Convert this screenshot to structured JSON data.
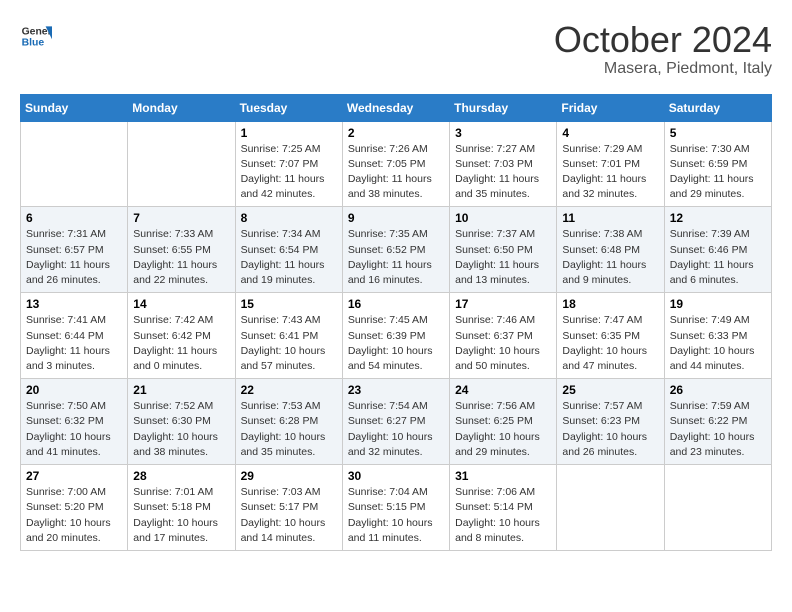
{
  "logo": {
    "line1": "General",
    "line2": "Blue"
  },
  "title": "October 2024",
  "subtitle": "Masera, Piedmont, Italy",
  "header_days": [
    "Sunday",
    "Monday",
    "Tuesday",
    "Wednesday",
    "Thursday",
    "Friday",
    "Saturday"
  ],
  "weeks": [
    [
      {
        "day": "",
        "sunrise": "",
        "sunset": "",
        "daylight": ""
      },
      {
        "day": "",
        "sunrise": "",
        "sunset": "",
        "daylight": ""
      },
      {
        "day": "1",
        "sunrise": "Sunrise: 7:25 AM",
        "sunset": "Sunset: 7:07 PM",
        "daylight": "Daylight: 11 hours and 42 minutes."
      },
      {
        "day": "2",
        "sunrise": "Sunrise: 7:26 AM",
        "sunset": "Sunset: 7:05 PM",
        "daylight": "Daylight: 11 hours and 38 minutes."
      },
      {
        "day": "3",
        "sunrise": "Sunrise: 7:27 AM",
        "sunset": "Sunset: 7:03 PM",
        "daylight": "Daylight: 11 hours and 35 minutes."
      },
      {
        "day": "4",
        "sunrise": "Sunrise: 7:29 AM",
        "sunset": "Sunset: 7:01 PM",
        "daylight": "Daylight: 11 hours and 32 minutes."
      },
      {
        "day": "5",
        "sunrise": "Sunrise: 7:30 AM",
        "sunset": "Sunset: 6:59 PM",
        "daylight": "Daylight: 11 hours and 29 minutes."
      }
    ],
    [
      {
        "day": "6",
        "sunrise": "Sunrise: 7:31 AM",
        "sunset": "Sunset: 6:57 PM",
        "daylight": "Daylight: 11 hours and 26 minutes."
      },
      {
        "day": "7",
        "sunrise": "Sunrise: 7:33 AM",
        "sunset": "Sunset: 6:55 PM",
        "daylight": "Daylight: 11 hours and 22 minutes."
      },
      {
        "day": "8",
        "sunrise": "Sunrise: 7:34 AM",
        "sunset": "Sunset: 6:54 PM",
        "daylight": "Daylight: 11 hours and 19 minutes."
      },
      {
        "day": "9",
        "sunrise": "Sunrise: 7:35 AM",
        "sunset": "Sunset: 6:52 PM",
        "daylight": "Daylight: 11 hours and 16 minutes."
      },
      {
        "day": "10",
        "sunrise": "Sunrise: 7:37 AM",
        "sunset": "Sunset: 6:50 PM",
        "daylight": "Daylight: 11 hours and 13 minutes."
      },
      {
        "day": "11",
        "sunrise": "Sunrise: 7:38 AM",
        "sunset": "Sunset: 6:48 PM",
        "daylight": "Daylight: 11 hours and 9 minutes."
      },
      {
        "day": "12",
        "sunrise": "Sunrise: 7:39 AM",
        "sunset": "Sunset: 6:46 PM",
        "daylight": "Daylight: 11 hours and 6 minutes."
      }
    ],
    [
      {
        "day": "13",
        "sunrise": "Sunrise: 7:41 AM",
        "sunset": "Sunset: 6:44 PM",
        "daylight": "Daylight: 11 hours and 3 minutes."
      },
      {
        "day": "14",
        "sunrise": "Sunrise: 7:42 AM",
        "sunset": "Sunset: 6:42 PM",
        "daylight": "Daylight: 11 hours and 0 minutes."
      },
      {
        "day": "15",
        "sunrise": "Sunrise: 7:43 AM",
        "sunset": "Sunset: 6:41 PM",
        "daylight": "Daylight: 10 hours and 57 minutes."
      },
      {
        "day": "16",
        "sunrise": "Sunrise: 7:45 AM",
        "sunset": "Sunset: 6:39 PM",
        "daylight": "Daylight: 10 hours and 54 minutes."
      },
      {
        "day": "17",
        "sunrise": "Sunrise: 7:46 AM",
        "sunset": "Sunset: 6:37 PM",
        "daylight": "Daylight: 10 hours and 50 minutes."
      },
      {
        "day": "18",
        "sunrise": "Sunrise: 7:47 AM",
        "sunset": "Sunset: 6:35 PM",
        "daylight": "Daylight: 10 hours and 47 minutes."
      },
      {
        "day": "19",
        "sunrise": "Sunrise: 7:49 AM",
        "sunset": "Sunset: 6:33 PM",
        "daylight": "Daylight: 10 hours and 44 minutes."
      }
    ],
    [
      {
        "day": "20",
        "sunrise": "Sunrise: 7:50 AM",
        "sunset": "Sunset: 6:32 PM",
        "daylight": "Daylight: 10 hours and 41 minutes."
      },
      {
        "day": "21",
        "sunrise": "Sunrise: 7:52 AM",
        "sunset": "Sunset: 6:30 PM",
        "daylight": "Daylight: 10 hours and 38 minutes."
      },
      {
        "day": "22",
        "sunrise": "Sunrise: 7:53 AM",
        "sunset": "Sunset: 6:28 PM",
        "daylight": "Daylight: 10 hours and 35 minutes."
      },
      {
        "day": "23",
        "sunrise": "Sunrise: 7:54 AM",
        "sunset": "Sunset: 6:27 PM",
        "daylight": "Daylight: 10 hours and 32 minutes."
      },
      {
        "day": "24",
        "sunrise": "Sunrise: 7:56 AM",
        "sunset": "Sunset: 6:25 PM",
        "daylight": "Daylight: 10 hours and 29 minutes."
      },
      {
        "day": "25",
        "sunrise": "Sunrise: 7:57 AM",
        "sunset": "Sunset: 6:23 PM",
        "daylight": "Daylight: 10 hours and 26 minutes."
      },
      {
        "day": "26",
        "sunrise": "Sunrise: 7:59 AM",
        "sunset": "Sunset: 6:22 PM",
        "daylight": "Daylight: 10 hours and 23 minutes."
      }
    ],
    [
      {
        "day": "27",
        "sunrise": "Sunrise: 7:00 AM",
        "sunset": "Sunset: 5:20 PM",
        "daylight": "Daylight: 10 hours and 20 minutes."
      },
      {
        "day": "28",
        "sunrise": "Sunrise: 7:01 AM",
        "sunset": "Sunset: 5:18 PM",
        "daylight": "Daylight: 10 hours and 17 minutes."
      },
      {
        "day": "29",
        "sunrise": "Sunrise: 7:03 AM",
        "sunset": "Sunset: 5:17 PM",
        "daylight": "Daylight: 10 hours and 14 minutes."
      },
      {
        "day": "30",
        "sunrise": "Sunrise: 7:04 AM",
        "sunset": "Sunset: 5:15 PM",
        "daylight": "Daylight: 10 hours and 11 minutes."
      },
      {
        "day": "31",
        "sunrise": "Sunrise: 7:06 AM",
        "sunset": "Sunset: 5:14 PM",
        "daylight": "Daylight: 10 hours and 8 minutes."
      },
      {
        "day": "",
        "sunrise": "",
        "sunset": "",
        "daylight": ""
      },
      {
        "day": "",
        "sunrise": "",
        "sunset": "",
        "daylight": ""
      }
    ]
  ]
}
